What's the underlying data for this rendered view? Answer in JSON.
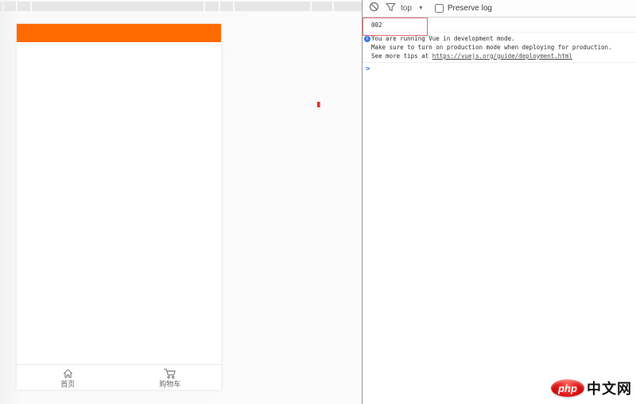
{
  "app": {
    "header": {
      "color": "#ff6a00"
    },
    "tabbar": {
      "items": [
        {
          "label": "首页",
          "icon": "home-icon"
        },
        {
          "label": "购物车",
          "icon": "cart-icon"
        }
      ]
    }
  },
  "devtools": {
    "toolbar": {
      "context": "top",
      "preserve_log_label": "Preserve log",
      "preserve_log_checked": false
    },
    "console": {
      "log1": "002",
      "info": {
        "line1": "You are running Vue in development mode.",
        "line2": "Make sure to turn on production mode when deploying for production.",
        "line3_prefix": "See more tips at ",
        "line3_link": "https://vuejs.org/guide/deployment.html"
      },
      "prompt": ">"
    },
    "colors": {
      "accent_blue": "#4d90fe",
      "annotation_red": "#e06a6a",
      "info_icon_blue": "#3b78e7"
    }
  },
  "watermark": {
    "php": "php",
    "suffix": "中文网"
  }
}
